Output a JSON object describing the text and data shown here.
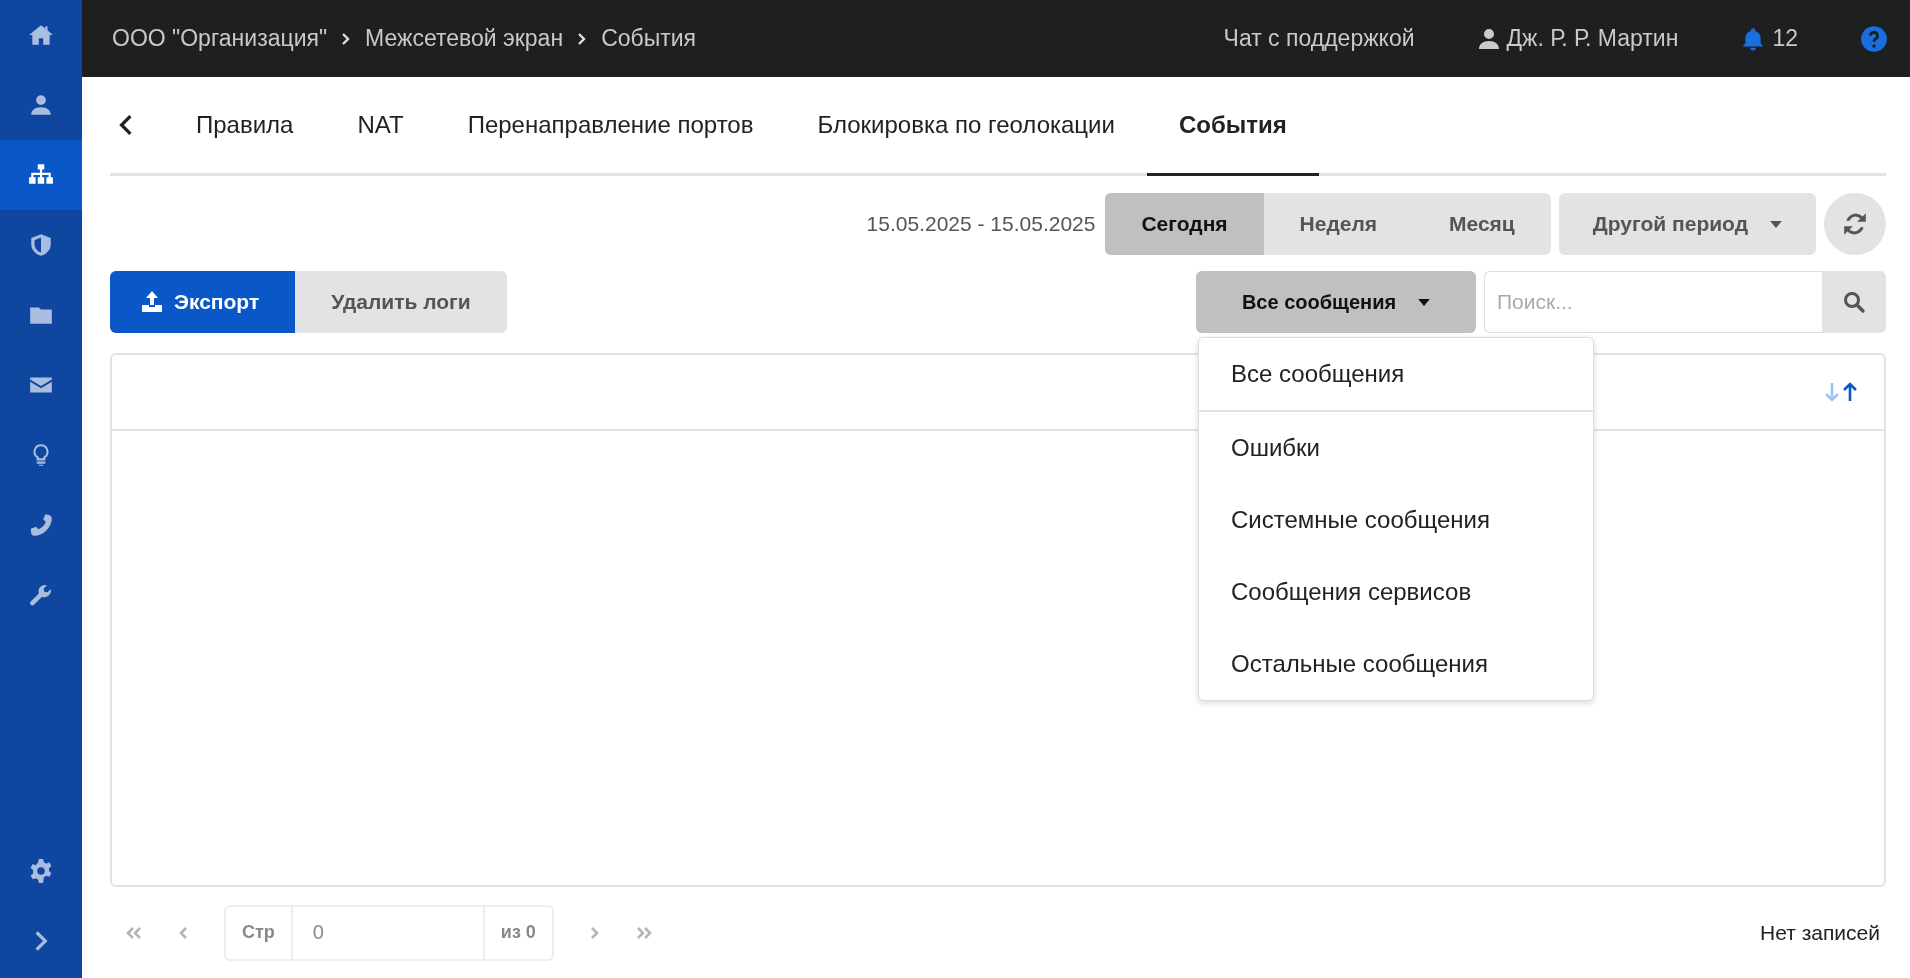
{
  "sidebar": {
    "items": [
      {
        "selected": false
      },
      {
        "selected": false
      },
      {
        "selected": true
      },
      {
        "selected": false
      },
      {
        "selected": false
      },
      {
        "selected": false
      },
      {
        "selected": false
      },
      {
        "selected": false
      },
      {
        "selected": false
      }
    ],
    "bottom_items": [
      {
        "selected": false
      },
      {
        "selected": false
      }
    ]
  },
  "top_bar": {
    "breadcrumbs": [
      "ООО \"Организация\"",
      "Межсетевой экран",
      "События"
    ],
    "support_chat": "Чат с поддержкой",
    "user": "Дж. Р. Р. Мартин",
    "notifications": "12"
  },
  "tabs": [
    {
      "label": "Правила",
      "selected": false
    },
    {
      "label": "NAT",
      "selected": false
    },
    {
      "label": "Перенаправление портов",
      "selected": false
    },
    {
      "label": "Блокировка по геолокации",
      "selected": false
    },
    {
      "label": "События",
      "selected": true
    }
  ],
  "date_range": "15.05.2025 - 15.05.2025",
  "periods": [
    {
      "label": "Сегодня",
      "selected": true
    },
    {
      "label": "Неделя",
      "selected": false
    },
    {
      "label": "Месяц",
      "selected": false
    }
  ],
  "other_period": "Другой период",
  "export_button": "Экспорт",
  "delete_logs_button": "Удалить логи",
  "filter": {
    "value": "Все сообщения",
    "options": [
      {
        "label": "Все сообщения",
        "selected": true
      },
      {
        "label": "Ошибки",
        "selected": false
      },
      {
        "label": "Системные сообщения",
        "selected": false
      },
      {
        "label": "Сообщения сервисов",
        "selected": false
      },
      {
        "label": "Остальные сообщения",
        "selected": false
      }
    ]
  },
  "search": {
    "placeholder": "Поиск..."
  },
  "table": {
    "sorted_ascending": true
  },
  "pagination": {
    "page_label": "Стр",
    "page": "0",
    "of_total": "из 0",
    "status": "Нет записей"
  }
}
